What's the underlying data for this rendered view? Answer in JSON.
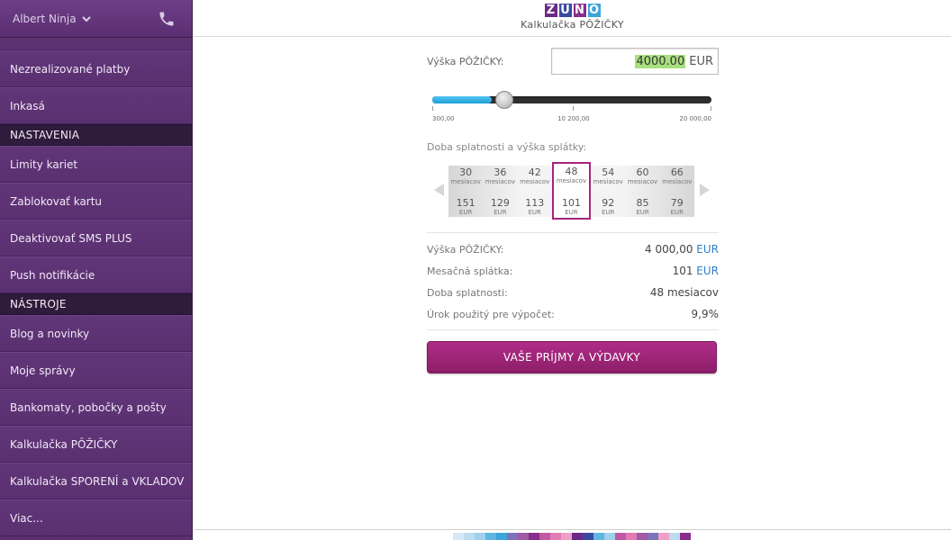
{
  "sidebar": {
    "user_name": "Albert Ninja",
    "items": [
      {
        "type": "item",
        "label": "Nezrealizované platby"
      },
      {
        "type": "item",
        "label": "Inkasá"
      },
      {
        "type": "section",
        "label": "NASTAVENIA"
      },
      {
        "type": "item",
        "label": "Limity kariet"
      },
      {
        "type": "item",
        "label": "Zablokovať kartu"
      },
      {
        "type": "item",
        "label": "Deaktivovať SMS PLUS"
      },
      {
        "type": "item",
        "label": "Push notifikácie"
      },
      {
        "type": "section",
        "label": "NÁSTROJE"
      },
      {
        "type": "item",
        "label": "Blog a novinky"
      },
      {
        "type": "item",
        "label": "Moje správy"
      },
      {
        "type": "item",
        "label": "Bankomaty, pobočky a pošty"
      },
      {
        "type": "item",
        "label": "Kalkulačka PÔŽIČKY"
      },
      {
        "type": "item",
        "label": "Kalkulačka SPORENÍ a VKLADOV"
      },
      {
        "type": "item",
        "label": "Viac..."
      }
    ]
  },
  "header": {
    "logo_letters": [
      "Z",
      "U",
      "N",
      "O"
    ],
    "title": "Kalkulačka PÔŽIČKY"
  },
  "calculator": {
    "amount_label": "Výška PÔŽIČKY:",
    "amount_value": "4000.00",
    "amount_currency": "EUR",
    "slider": {
      "min": 300,
      "max": 20000,
      "value": 4000,
      "tick_labels": [
        "300,00",
        "10 200,00",
        "20 000,00"
      ]
    },
    "period_label": "Doba splatnosti a výška splátky:",
    "period_options": [
      {
        "months": "30",
        "months_unit": "mesiacov",
        "payment": "151",
        "currency": "EUR"
      },
      {
        "months": "36",
        "months_unit": "mesiacov",
        "payment": "129",
        "currency": "EUR"
      },
      {
        "months": "42",
        "months_unit": "mesiacov",
        "payment": "113",
        "currency": "EUR"
      },
      {
        "months": "48",
        "months_unit": "mesiacov",
        "payment": "101",
        "currency": "EUR"
      },
      {
        "months": "54",
        "months_unit": "mesiacov",
        "payment": "92",
        "currency": "EUR"
      },
      {
        "months": "60",
        "months_unit": "mesiacov",
        "payment": "85",
        "currency": "EUR"
      },
      {
        "months": "66",
        "months_unit": "mesiacov",
        "payment": "79",
        "currency": "EUR"
      }
    ],
    "selected_period_index": 3,
    "summary": [
      {
        "label": "Výška PÔŽIČKY:",
        "value": "4 000,00",
        "currency": "EUR"
      },
      {
        "label": "Mesačná splátka:",
        "value": "101",
        "currency": "EUR"
      },
      {
        "label": "Doba splatnosti:",
        "value": "48 mesiacov",
        "currency": ""
      },
      {
        "label": "Úrok použitý pre výpočet:",
        "value": "9,9%",
        "currency": ""
      }
    ],
    "cta_label": "VAŠE PRÍJMY A VÝDAVKY"
  },
  "colors": {
    "sidebar_bg": "#5a3070",
    "accent": "#a8237c",
    "slider_fill": "#1da0d8",
    "highlight": "#a8e07e",
    "currency_blue": "#2f7fc4"
  },
  "bottom_strip_colors": [
    "#d7e9f6",
    "#bcdcf0",
    "#9fd0ec",
    "#5fb6e2",
    "#3da5d9",
    "#7f73b8",
    "#a05aa6",
    "#8a2d8c",
    "#c25aa3",
    "#e27bb6",
    "#f0a0c8",
    "#6a2a86",
    "#3a4aa0",
    "#5fb6e2",
    "#9fd0ec",
    "#c25aa3",
    "#e27bb6",
    "#a05aa6",
    "#7f73b8",
    "#f0a0c8",
    "#bcdcf0",
    "#8a2d8c"
  ]
}
